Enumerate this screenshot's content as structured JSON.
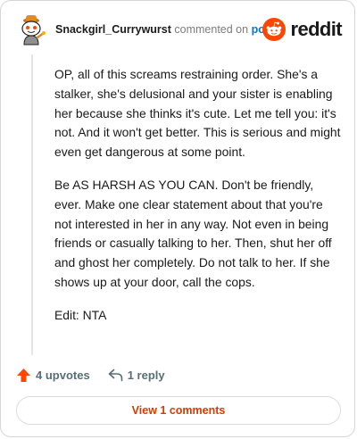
{
  "comment": {
    "username": "Snackgirl_Currywurst",
    "action_text": "commented on",
    "post_link_label": "post",
    "brand": "reddit",
    "paragraphs": [
      "OP, all of this screams restraining order. She's a stalker, she's delusional and your sister is enabling her because she thinks it's cute. Let me tell you: it's not. And it won't get better. This is serious and might even get dangerous at some point.",
      "Be AS HARSH AS YOU CAN. Don't be friendly, ever. Make one clear statement about that you're not interested in her in any way. Not even in being friends or casually talking to her. Then, shut her off and ghost her completely. Do not talk to her. If she shows up at your door, call the cops.",
      "Edit: NTA"
    ]
  },
  "actions": {
    "upvotes_label": "4 upvotes",
    "replies_label": "1 reply",
    "view_comments_label": "View 1 comments"
  },
  "colors": {
    "brand_orange": "#ff4500",
    "link_blue": "#0079d3",
    "view_button_text": "#d93a00",
    "muted_text": "#576f76"
  },
  "icons": {
    "avatar": "snoo-avatar-icon",
    "brand": "reddit-snoo-icon",
    "upvote": "upvote-arrow-icon",
    "reply": "reply-arrow-icon"
  }
}
